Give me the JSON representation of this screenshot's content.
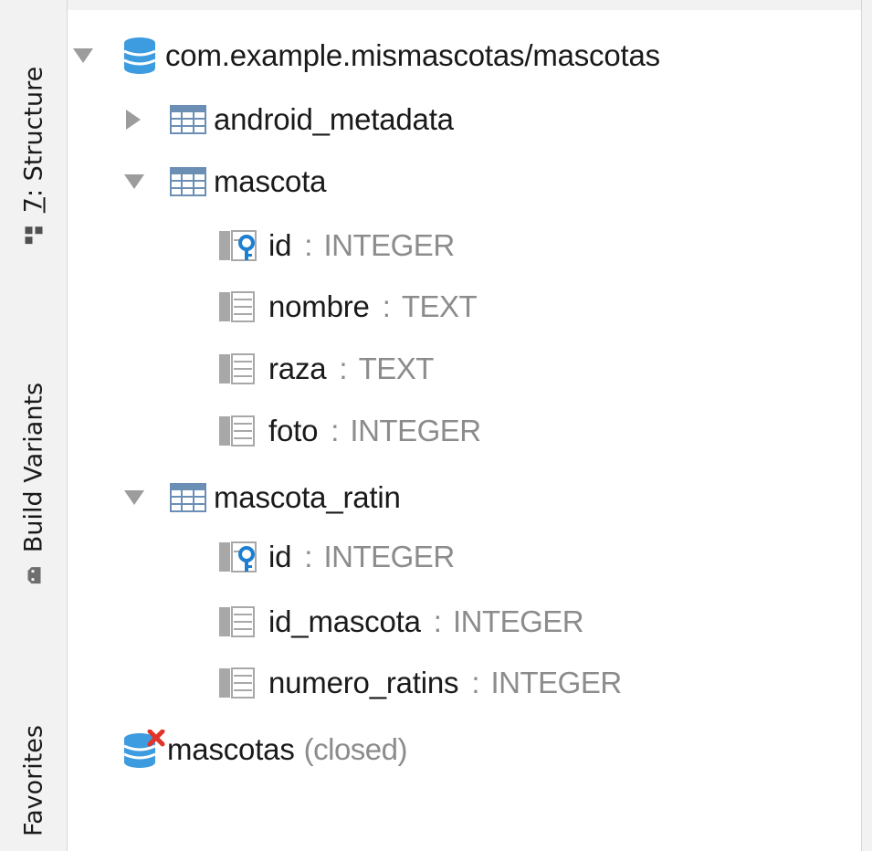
{
  "side_tabs": {
    "structure": {
      "prefix": "7",
      "label": ": Structure"
    },
    "build_variants": {
      "label": "Build Variants"
    },
    "favorites": {
      "label": "Favorites"
    }
  },
  "tree": {
    "database": {
      "name": "com.example.mismascotas/mascotas",
      "icon": "database-icon",
      "expanded": true
    },
    "tables": [
      {
        "name": "android_metadata",
        "icon": "table-icon",
        "expanded": false,
        "columns": []
      },
      {
        "name": "mascota",
        "icon": "table-icon",
        "expanded": true,
        "columns": [
          {
            "name": "id",
            "separator": ":",
            "type": "INTEGER",
            "icon": "primary-key-column-icon"
          },
          {
            "name": "nombre",
            "separator": ":",
            "type": "TEXT",
            "icon": "column-icon"
          },
          {
            "name": "raza",
            "separator": ":",
            "type": "TEXT",
            "icon": "column-icon"
          },
          {
            "name": "foto",
            "separator": ":",
            "type": "INTEGER",
            "icon": "column-icon"
          }
        ]
      },
      {
        "name": "mascota_ratin",
        "icon": "table-icon",
        "expanded": true,
        "columns": [
          {
            "name": "id",
            "separator": ":",
            "type": "INTEGER",
            "icon": "primary-key-column-icon"
          },
          {
            "name": "id_mascota",
            "separator": ":",
            "type": "INTEGER",
            "icon": "column-icon"
          },
          {
            "name": "numero_ratins",
            "separator": ":",
            "type": "INTEGER",
            "icon": "column-icon"
          }
        ]
      }
    ],
    "closed_database": {
      "name": "mascotas",
      "status": "(closed)",
      "icon": "closed-database-icon"
    }
  },
  "colors": {
    "database_blue": "#3d9be0",
    "table_icon": "#6b8fb4",
    "column_icon": "#a8a8a8",
    "key_blue": "#1e7fd0",
    "closed_red": "#e0342a",
    "type_gray": "#8c8c8c"
  }
}
